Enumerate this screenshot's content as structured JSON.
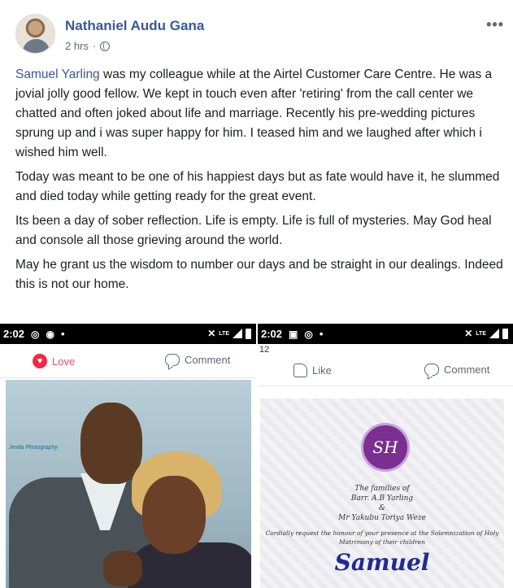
{
  "post": {
    "author": "Nathaniel Audu Gana",
    "timestamp": "2 hrs",
    "separator": "·",
    "more": "•••",
    "mention": "Samuel Yarling",
    "p1_rest": " was my colleague while at the Airtel Customer Care Centre. He was a jovial jolly good fellow. We kept in touch even after 'retiring' from the call center we chatted and often joked about life and marriage. Recently his pre-wedding pictures sprung up and i was super happy for him. I teased him and we laughed after which i wished him well.",
    "p2": "Today was meant to be one of his happiest days but as fate would have it, he slummed and died today while getting ready for the great event.",
    "p3": "Its been a day of sober reflection. Life is empty. Life is full of mysteries. May God heal and console all those grieving around the world.",
    "p4": "May he grant us the wisdom to number our days and be straight in our dealings. Indeed this is not our home."
  },
  "gallery": {
    "left": {
      "time": "2:02",
      "reaction_label": "Love",
      "comment_label": "Comment",
      "watermark": "Jevita Photography",
      "status_dot": "•"
    },
    "right": {
      "time": "2:02",
      "scroll_number": "12",
      "like_label": "Like",
      "comment_label": "Comment",
      "monogram": "SH",
      "families_line": "The families of",
      "family1": "Barr. A.B Yarling",
      "ampersand": "&",
      "family2": "Mr Yakubu Toriya Weze",
      "request_line": "Cordially request the honour of your presence at the Solemnization of Holy",
      "request_line2": "Matrimony of their children",
      "groom": "Samuel",
      "status_dot": "•"
    }
  }
}
